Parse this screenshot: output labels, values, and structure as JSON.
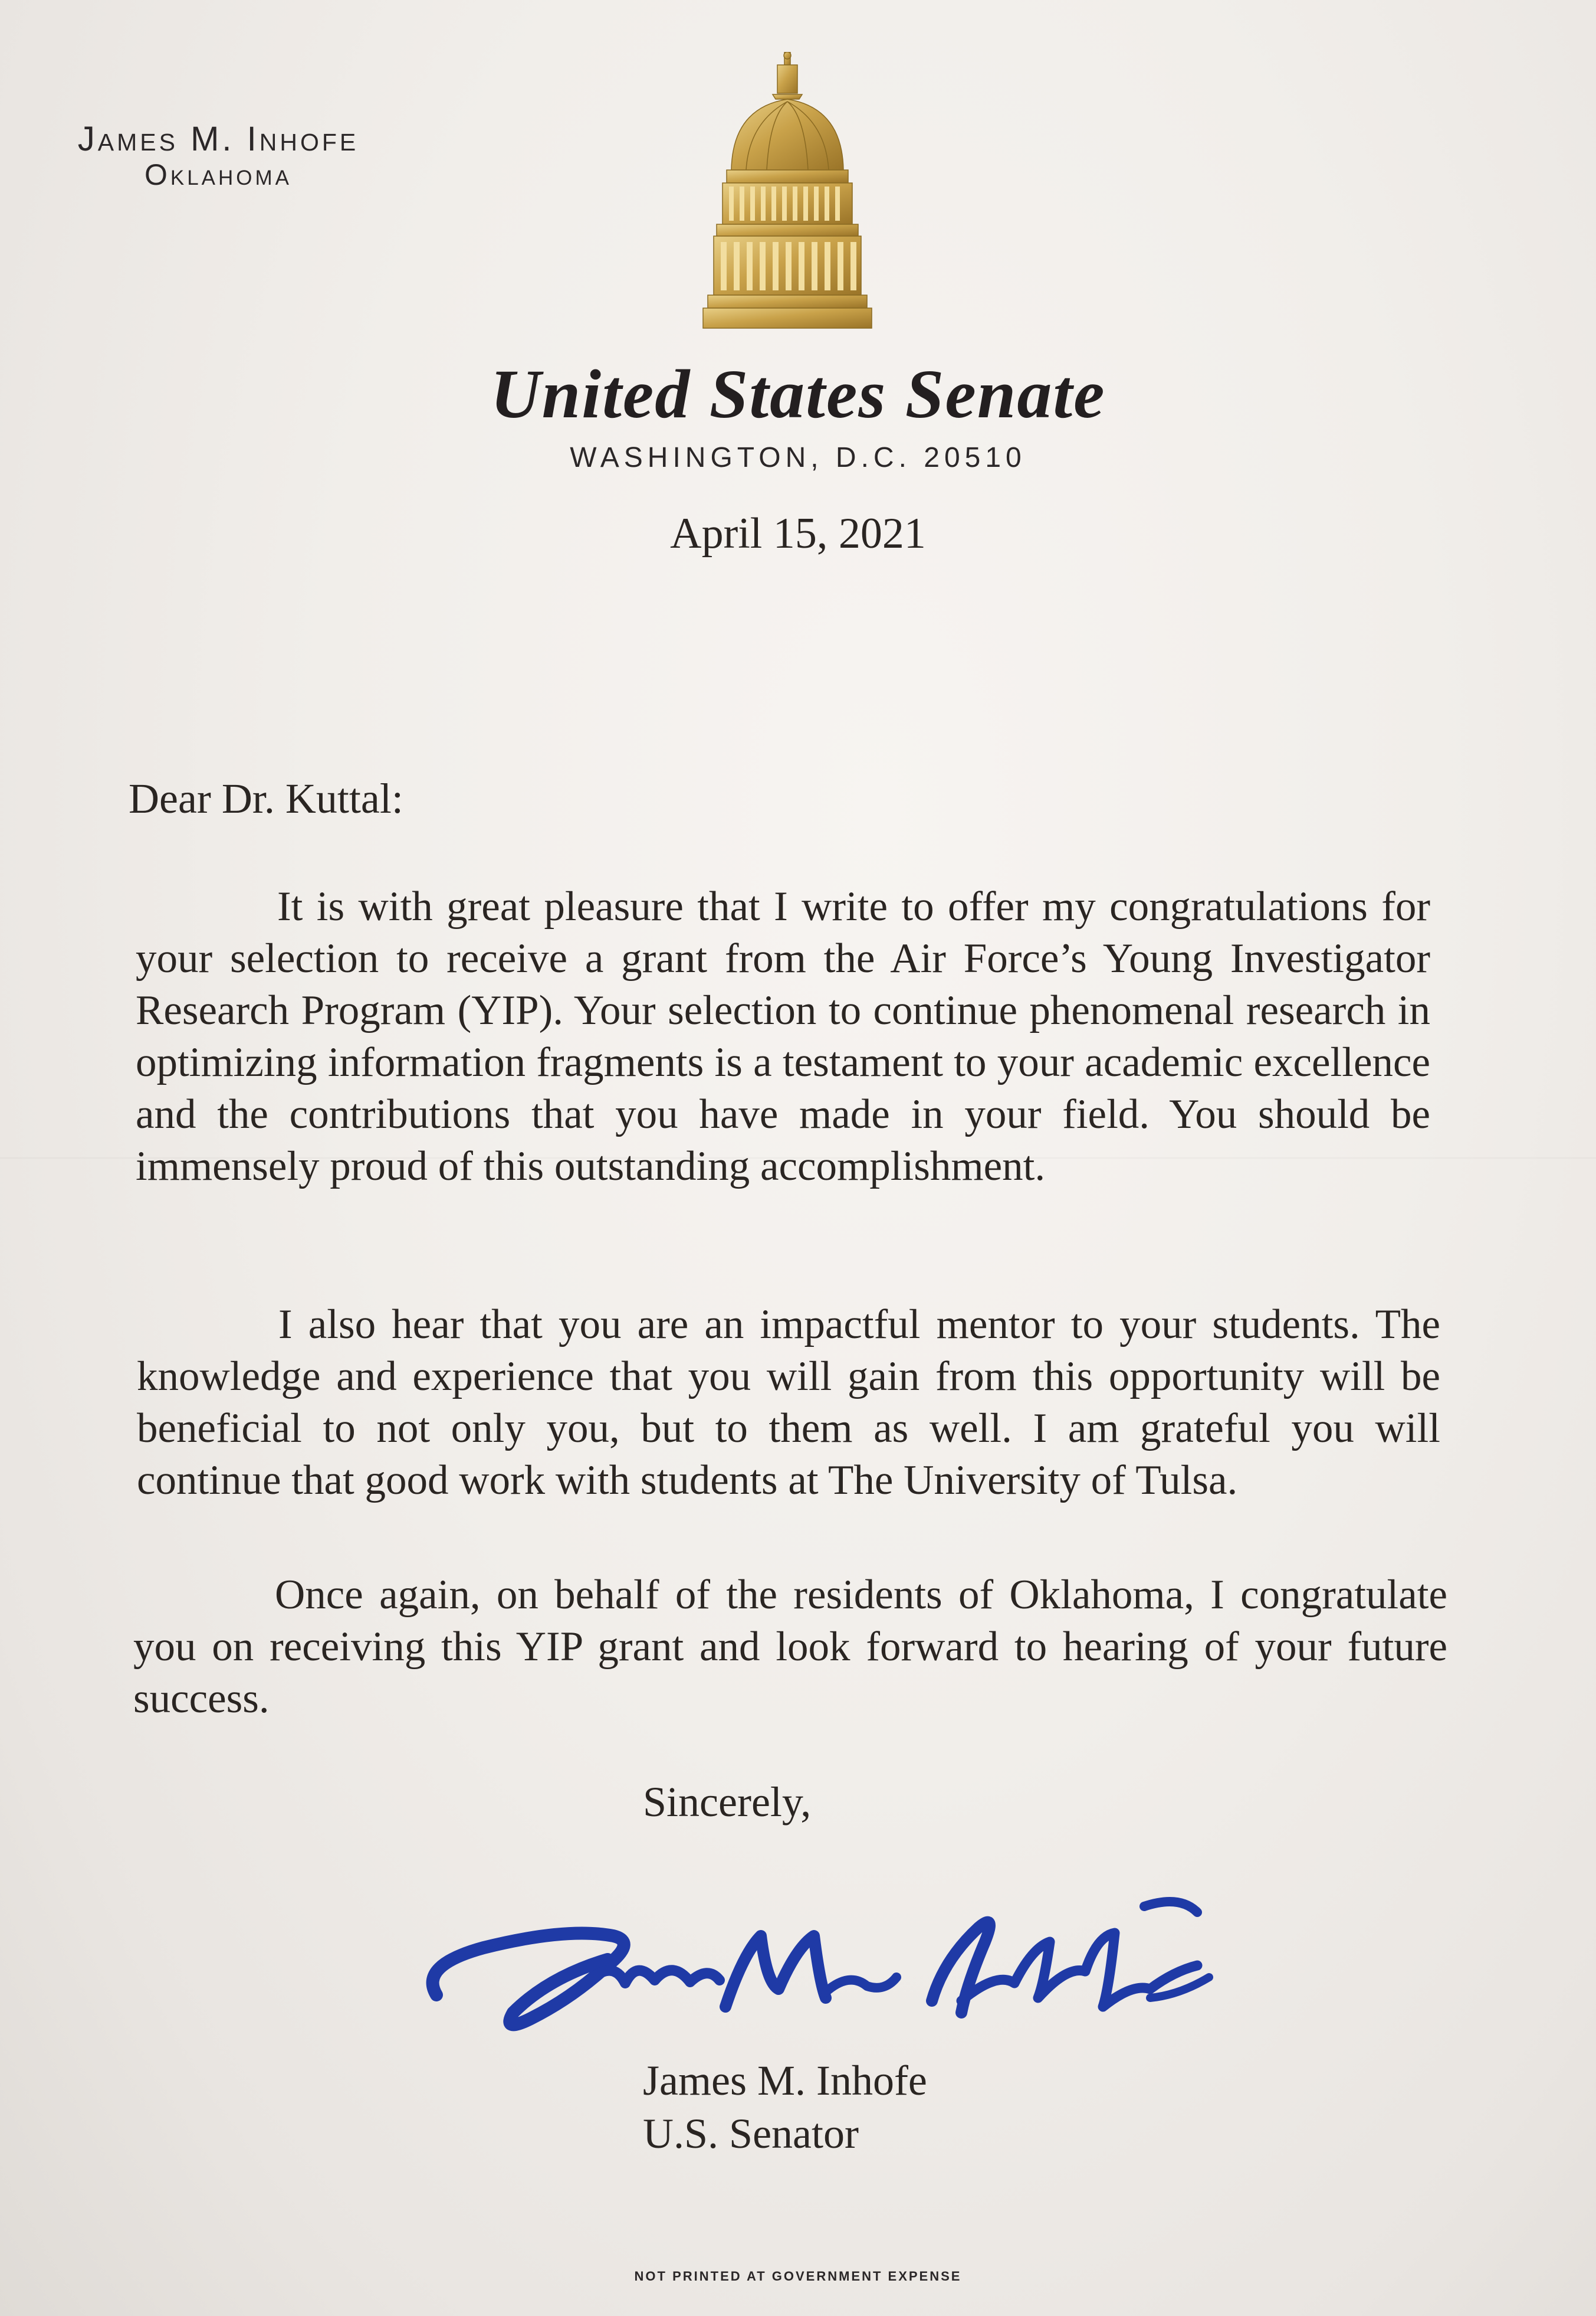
{
  "letterhead": {
    "sender_name": "James M. Inhofe",
    "sender_state": "Oklahoma",
    "institution": "United States Senate",
    "address": "WASHINGTON, D.C. 20510",
    "emblem_icon": "capitol-dome-icon"
  },
  "letter": {
    "date": "April 15, 2021",
    "salutation": "Dear Dr. Kuttal:",
    "paragraphs": [
      "It is with great pleasure that I write to offer my congratulations for your selection to receive a grant from the Air Force’s Young Investigator Research Program (YIP). Your selection to continue phenomenal research in optimizing information fragments is a testament to your academic excellence and the contributions that you have made in your field. You should be immensely proud of this outstanding accomplishment.",
      "I also hear that you are an impactful mentor to your students. The knowledge and experience that you will gain from this opportunity will be beneficial to not only you, but to them as well. I am grateful you will continue that good work with students at The University of Tulsa.",
      "Once again, on behalf of the residents of Oklahoma, I congratulate you on receiving this YIP grant and look forward to hearing of your future success."
    ],
    "closing": "Sincerely,",
    "signature_text": "James M. Inhofe",
    "signer_name": "James M. Inhofe",
    "signer_title": "U.S. Senator"
  },
  "footer": {
    "note": "NOT PRINTED AT GOVERNMENT EXPENSE"
  },
  "colors": {
    "paper": "#f1eeea",
    "ink": "#2a2522",
    "gold": "#c9a24a",
    "signature_blue": "#1f3aa6"
  }
}
